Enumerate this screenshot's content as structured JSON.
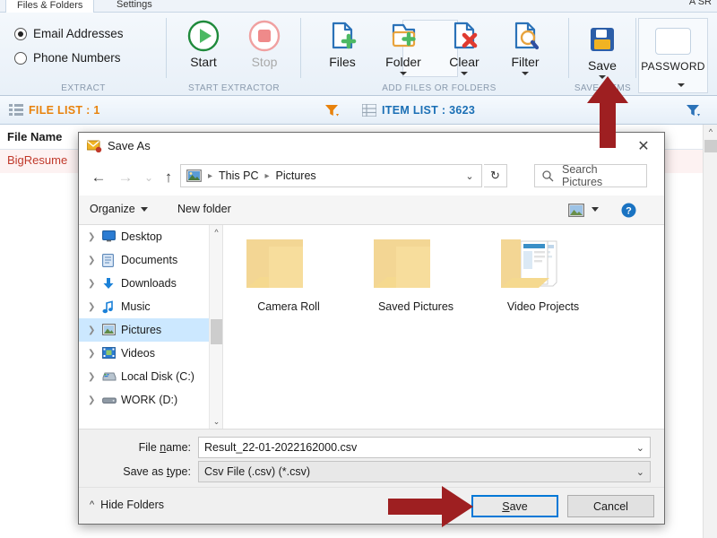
{
  "app": {
    "tabs": [
      {
        "label": "Files & Folders",
        "active": true
      },
      {
        "label": "Settings",
        "active": false
      }
    ],
    "top_right_cut": "A  SR",
    "ribbon": {
      "extract": {
        "caption": "EXTRACT",
        "options": [
          {
            "label": "Email Addresses",
            "selected": true
          },
          {
            "label": "Phone Numbers",
            "selected": false
          }
        ]
      },
      "start_extractor": {
        "caption": "START EXTRACTOR",
        "buttons": [
          {
            "label": "Start",
            "icon": "play-icon",
            "enabled": true
          },
          {
            "label": "Stop",
            "icon": "stop-icon",
            "enabled": false
          }
        ]
      },
      "add_files": {
        "caption": "ADD FILES OR FOLDERS",
        "buttons": [
          {
            "label": "Files",
            "icon": "file-add-icon"
          },
          {
            "label": "Folder",
            "icon": "folder-add-icon"
          },
          {
            "label": "Clear",
            "icon": "file-clear-icon"
          },
          {
            "label": "Filter",
            "icon": "file-filter-icon"
          }
        ]
      },
      "save_items": {
        "caption": "SAVE ITEMS",
        "button": {
          "label": "Save",
          "icon": "floppy-disk-icon",
          "highlighted": true
        }
      },
      "password": {
        "label": "PASSWORD"
      }
    },
    "listbar": {
      "file_list": "FILE LIST : 1",
      "item_list": "ITEM LIST : 3623",
      "filter_icon": "filter-icon"
    },
    "grid": {
      "header": "File Name",
      "row": "BigResume"
    },
    "colors": {
      "orange": "#e8820c",
      "blue": "#1a6fb5",
      "red_row": "#c0392b",
      "highlight_red": "#e3554a",
      "arrow_red": "#9e1f21",
      "focus_blue": "#0078d7"
    }
  },
  "dialog": {
    "title": "Save As",
    "title_icon": "mail-save-icon",
    "close_icon": "close-icon",
    "nav": {
      "back_icon": "arrow-left-icon",
      "forward_icon": "arrow-right-icon",
      "recent_icon": "chevron-down-icon",
      "up_icon": "arrow-up-icon",
      "breadcrumb_icon": "pictures-icon",
      "breadcrumbs": [
        "This PC",
        "Pictures"
      ],
      "address_dropdown_icon": "chevron-down-icon",
      "refresh_icon": "refresh-icon",
      "search_icon": "search-icon",
      "search_placeholder": "Search Pictures"
    },
    "toolbar": {
      "organize": "Organize",
      "new_folder": "New folder",
      "view_icon": "view-layout-icon",
      "view_dropdown_icon": "chevron-down-icon",
      "help_icon": "help-icon"
    },
    "tree": [
      {
        "label": "Desktop",
        "icon": "desktop-icon",
        "selected": false
      },
      {
        "label": "Documents",
        "icon": "documents-icon",
        "selected": false
      },
      {
        "label": "Downloads",
        "icon": "downloads-icon",
        "selected": false
      },
      {
        "label": "Music",
        "icon": "music-icon",
        "selected": false
      },
      {
        "label": "Pictures",
        "icon": "pictures-icon",
        "selected": true
      },
      {
        "label": "Videos",
        "icon": "videos-icon",
        "selected": false
      },
      {
        "label": "Local Disk (C:)",
        "icon": "harddisk-icon",
        "selected": false
      },
      {
        "label": "WORK (D:)",
        "icon": "drive-icon",
        "selected": false
      }
    ],
    "folders": [
      {
        "label": "Camera Roll",
        "icon": "folder-icon"
      },
      {
        "label": "Saved Pictures",
        "icon": "folder-icon"
      },
      {
        "label": "Video Projects",
        "icon": "folder-with-content-icon"
      }
    ],
    "fields": {
      "file_name_label": "File name:",
      "file_name_value": "Result_22-01-2022162000.csv",
      "save_as_type_label": "Save as type:",
      "save_as_type_value": "Csv File (.csv) (*.csv)",
      "dropdown_icon": "chevron-down-icon"
    },
    "footer": {
      "hide_folders": "Hide Folders",
      "hide_folders_icon": "chevron-up-icon",
      "save_button": "Save",
      "cancel_button": "Cancel"
    }
  }
}
